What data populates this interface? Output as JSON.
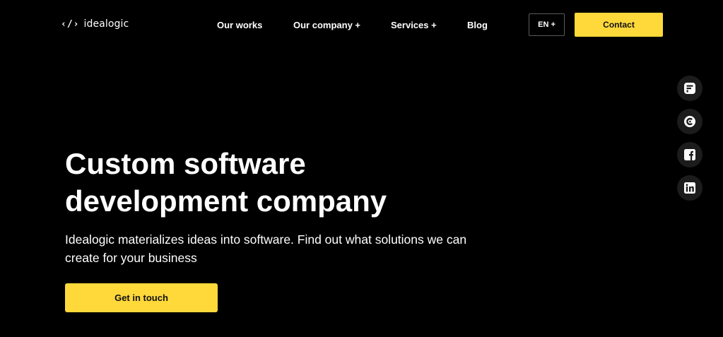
{
  "header": {
    "logo": {
      "mark": "‹/›",
      "text": "idealogic"
    },
    "nav": [
      {
        "label": "Our works"
      },
      {
        "label": "Our company +"
      },
      {
        "label": "Services +"
      },
      {
        "label": "Blog"
      }
    ],
    "language_label": "EN +",
    "contact_label": "Contact"
  },
  "social": [
    {
      "icon": "clutch-f-icon"
    },
    {
      "icon": "clutch-c-icon"
    },
    {
      "icon": "facebook-icon"
    },
    {
      "icon": "linkedin-icon"
    }
  ],
  "hero": {
    "title_line1": "Custom software",
    "title_line2": "development company",
    "subtitle": "Idealogic materializes ideas into software. Find out what solutions we can create for your business",
    "cta_label": "Get in touch"
  },
  "colors": {
    "background": "#000000",
    "accent": "#ffd83a",
    "social_bg": "#1c1c1c"
  }
}
